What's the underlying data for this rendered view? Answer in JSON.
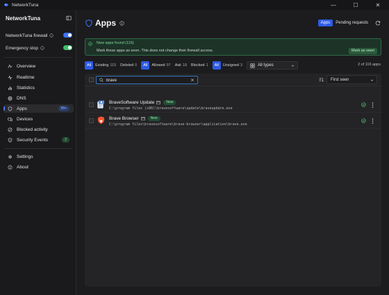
{
  "window": {
    "title": "NetworkTuna",
    "controls": {
      "minimize": "—",
      "maximize": "☐",
      "close": "✕"
    }
  },
  "sidebar": {
    "header": "NetworkTuna",
    "firewall_label": "NetworkTuna firewall",
    "firewall_on": true,
    "emergency_label": "Emergency stop",
    "emergency_on": true,
    "nav": [
      {
        "label": "Overview",
        "icon": "pulse-icon"
      },
      {
        "label": "Realtime",
        "icon": "wave-icon"
      },
      {
        "label": "Statistics",
        "icon": "bar-chart-icon"
      },
      {
        "label": "DNS",
        "icon": "globe-icon"
      },
      {
        "label": "Apps",
        "icon": "shield-icon",
        "active": true,
        "badge": "99+"
      },
      {
        "label": "Devices",
        "icon": "devices-icon"
      },
      {
        "label": "Blocked activity",
        "icon": "block-icon"
      },
      {
        "label": "Security Events",
        "icon": "bolt-icon",
        "badge": "2"
      },
      {
        "label": "Settings",
        "icon": "gear-icon"
      },
      {
        "label": "About",
        "icon": "info-icon"
      }
    ]
  },
  "main": {
    "title": "Apps",
    "tabs": {
      "apps": "Apps",
      "pending": "Pending requests"
    },
    "banner": {
      "title": "New apps found (116)",
      "text": "Mark these apps as seen. This does not change their firewall access.",
      "button": "Mark as seen"
    },
    "filters": {
      "group1": [
        {
          "label": "All"
        },
        {
          "label": "Existing",
          "count": "115"
        },
        {
          "label": "Deleted",
          "count": "0"
        }
      ],
      "group2": [
        {
          "label": "All"
        },
        {
          "label": "Allowed",
          "count": "97"
        },
        {
          "label": "Ask",
          "count": "18"
        },
        {
          "label": "Blocked",
          "count": "1"
        }
      ],
      "group3": [
        {
          "label": "All"
        },
        {
          "label": "Unsigned",
          "count": "3"
        }
      ],
      "types_label": "All types",
      "count_text": "2 of 116 apps"
    },
    "search": {
      "value": "brave",
      "placeholder": "Search apps"
    },
    "sort": {
      "label": "First seen"
    },
    "rows": [
      {
        "name": "BraveSoftware Update",
        "badge": "New",
        "path": "C:\\program files (x86)\\bravesoftware\\update\\braveupdate.exe",
        "icon": "installer-icon"
      },
      {
        "name": "Brave Browser",
        "badge": "New",
        "path": "C:\\program files\\bravesoftware\\brave-browser\\application\\brave.exe",
        "icon": "brave-lion-icon"
      }
    ]
  },
  "colors": {
    "accent": "#2e5be6",
    "toggle_on_blue": "#3e74ff",
    "toggle_on_green": "#3fbf6a",
    "success": "#4fc97a",
    "badge_blue_bg": "#2a3d6b",
    "badge_green_bg": "#234a33"
  }
}
